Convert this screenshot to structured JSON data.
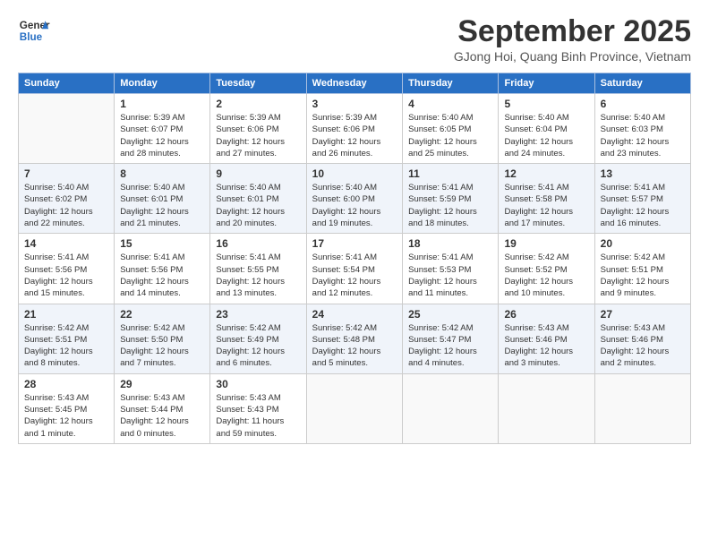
{
  "header": {
    "logo_line1": "General",
    "logo_line2": "Blue",
    "month": "September 2025",
    "location": "GJong Hoi, Quang Binh Province, Vietnam"
  },
  "weekdays": [
    "Sunday",
    "Monday",
    "Tuesday",
    "Wednesday",
    "Thursday",
    "Friday",
    "Saturday"
  ],
  "weeks": [
    [
      {
        "day": "",
        "info": ""
      },
      {
        "day": "1",
        "info": "Sunrise: 5:39 AM\nSunset: 6:07 PM\nDaylight: 12 hours\nand 28 minutes."
      },
      {
        "day": "2",
        "info": "Sunrise: 5:39 AM\nSunset: 6:06 PM\nDaylight: 12 hours\nand 27 minutes."
      },
      {
        "day": "3",
        "info": "Sunrise: 5:39 AM\nSunset: 6:06 PM\nDaylight: 12 hours\nand 26 minutes."
      },
      {
        "day": "4",
        "info": "Sunrise: 5:40 AM\nSunset: 6:05 PM\nDaylight: 12 hours\nand 25 minutes."
      },
      {
        "day": "5",
        "info": "Sunrise: 5:40 AM\nSunset: 6:04 PM\nDaylight: 12 hours\nand 24 minutes."
      },
      {
        "day": "6",
        "info": "Sunrise: 5:40 AM\nSunset: 6:03 PM\nDaylight: 12 hours\nand 23 minutes."
      }
    ],
    [
      {
        "day": "7",
        "info": "Sunrise: 5:40 AM\nSunset: 6:02 PM\nDaylight: 12 hours\nand 22 minutes."
      },
      {
        "day": "8",
        "info": "Sunrise: 5:40 AM\nSunset: 6:01 PM\nDaylight: 12 hours\nand 21 minutes."
      },
      {
        "day": "9",
        "info": "Sunrise: 5:40 AM\nSunset: 6:01 PM\nDaylight: 12 hours\nand 20 minutes."
      },
      {
        "day": "10",
        "info": "Sunrise: 5:40 AM\nSunset: 6:00 PM\nDaylight: 12 hours\nand 19 minutes."
      },
      {
        "day": "11",
        "info": "Sunrise: 5:41 AM\nSunset: 5:59 PM\nDaylight: 12 hours\nand 18 minutes."
      },
      {
        "day": "12",
        "info": "Sunrise: 5:41 AM\nSunset: 5:58 PM\nDaylight: 12 hours\nand 17 minutes."
      },
      {
        "day": "13",
        "info": "Sunrise: 5:41 AM\nSunset: 5:57 PM\nDaylight: 12 hours\nand 16 minutes."
      }
    ],
    [
      {
        "day": "14",
        "info": "Sunrise: 5:41 AM\nSunset: 5:56 PM\nDaylight: 12 hours\nand 15 minutes."
      },
      {
        "day": "15",
        "info": "Sunrise: 5:41 AM\nSunset: 5:56 PM\nDaylight: 12 hours\nand 14 minutes."
      },
      {
        "day": "16",
        "info": "Sunrise: 5:41 AM\nSunset: 5:55 PM\nDaylight: 12 hours\nand 13 minutes."
      },
      {
        "day": "17",
        "info": "Sunrise: 5:41 AM\nSunset: 5:54 PM\nDaylight: 12 hours\nand 12 minutes."
      },
      {
        "day": "18",
        "info": "Sunrise: 5:41 AM\nSunset: 5:53 PM\nDaylight: 12 hours\nand 11 minutes."
      },
      {
        "day": "19",
        "info": "Sunrise: 5:42 AM\nSunset: 5:52 PM\nDaylight: 12 hours\nand 10 minutes."
      },
      {
        "day": "20",
        "info": "Sunrise: 5:42 AM\nSunset: 5:51 PM\nDaylight: 12 hours\nand 9 minutes."
      }
    ],
    [
      {
        "day": "21",
        "info": "Sunrise: 5:42 AM\nSunset: 5:51 PM\nDaylight: 12 hours\nand 8 minutes."
      },
      {
        "day": "22",
        "info": "Sunrise: 5:42 AM\nSunset: 5:50 PM\nDaylight: 12 hours\nand 7 minutes."
      },
      {
        "day": "23",
        "info": "Sunrise: 5:42 AM\nSunset: 5:49 PM\nDaylight: 12 hours\nand 6 minutes."
      },
      {
        "day": "24",
        "info": "Sunrise: 5:42 AM\nSunset: 5:48 PM\nDaylight: 12 hours\nand 5 minutes."
      },
      {
        "day": "25",
        "info": "Sunrise: 5:42 AM\nSunset: 5:47 PM\nDaylight: 12 hours\nand 4 minutes."
      },
      {
        "day": "26",
        "info": "Sunrise: 5:43 AM\nSunset: 5:46 PM\nDaylight: 12 hours\nand 3 minutes."
      },
      {
        "day": "27",
        "info": "Sunrise: 5:43 AM\nSunset: 5:46 PM\nDaylight: 12 hours\nand 2 minutes."
      }
    ],
    [
      {
        "day": "28",
        "info": "Sunrise: 5:43 AM\nSunset: 5:45 PM\nDaylight: 12 hours\nand 1 minute."
      },
      {
        "day": "29",
        "info": "Sunrise: 5:43 AM\nSunset: 5:44 PM\nDaylight: 12 hours\nand 0 minutes."
      },
      {
        "day": "30",
        "info": "Sunrise: 5:43 AM\nSunset: 5:43 PM\nDaylight: 11 hours\nand 59 minutes."
      },
      {
        "day": "",
        "info": ""
      },
      {
        "day": "",
        "info": ""
      },
      {
        "day": "",
        "info": ""
      },
      {
        "day": "",
        "info": ""
      }
    ]
  ]
}
